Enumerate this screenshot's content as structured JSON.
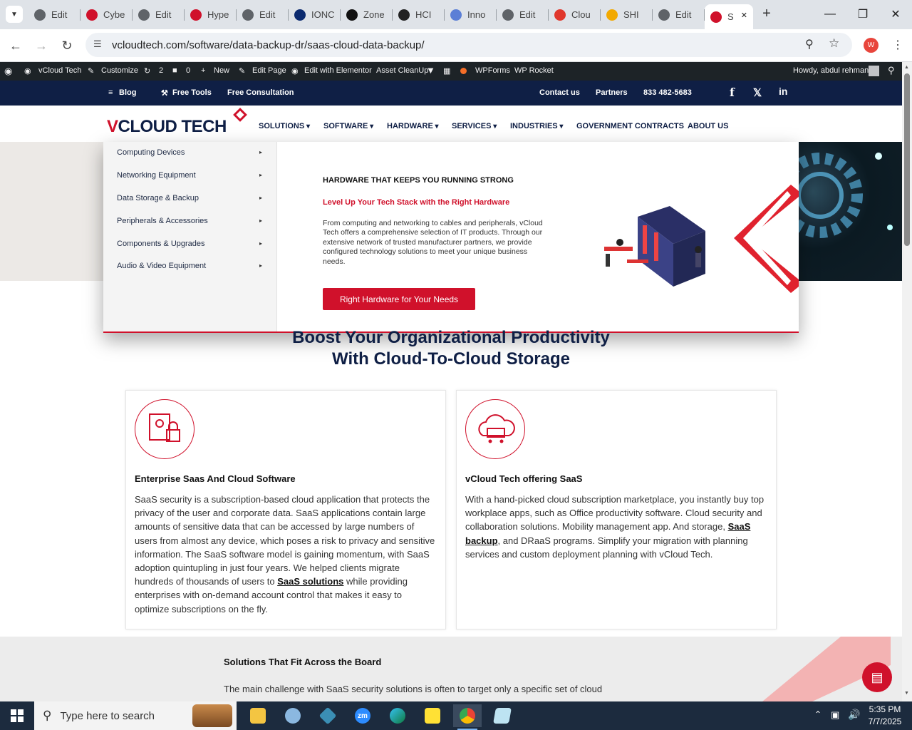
{
  "browser": {
    "tabs": [
      {
        "title": "Edit",
        "fav": "wordpress-icon",
        "color": "#5f6368"
      },
      {
        "title": "Cybe",
        "fav": "vcloud-diamond-icon",
        "color": "#d0112b"
      },
      {
        "title": "Edit",
        "fav": "wordpress-icon",
        "color": "#5f6368"
      },
      {
        "title": "Hype",
        "fav": "vcloud-diamond-icon",
        "color": "#d0112b"
      },
      {
        "title": "Edit",
        "fav": "wordpress-icon",
        "color": "#5f6368"
      },
      {
        "title": "IONC",
        "fav": "ionos-icon",
        "color": "#0b2a6f"
      },
      {
        "title": "Zone",
        "fav": "z-icon",
        "color": "#111111"
      },
      {
        "title": "HCI",
        "fav": "hci-icon",
        "color": "#222222"
      },
      {
        "title": "Inno",
        "fav": "inno-icon",
        "color": "#5b7fd6"
      },
      {
        "title": "Edit",
        "fav": "wordpress-icon",
        "color": "#5f6368"
      },
      {
        "title": "Clou",
        "fav": "cloud-swoosh-icon",
        "color": "#e0372c"
      },
      {
        "title": "SHI",
        "fav": "shi-icon",
        "color": "#f2a900"
      },
      {
        "title": "Edit",
        "fav": "wordpress-icon",
        "color": "#5f6368"
      },
      {
        "title": "S",
        "fav": "vcloud-diamond-icon",
        "color": "#d0112b"
      }
    ],
    "url": "vcloudtech.com/software/data-backup-dr/saas-cloud-data-backup/",
    "profile_initial": "W"
  },
  "wpbar": {
    "site": "vCloud Tech",
    "customize": "Customize",
    "updates": "2",
    "comments": "0",
    "new": "New",
    "edit_page": "Edit Page",
    "elementor": "Edit with Elementor",
    "asset_cleanup": "Asset CleanUp",
    "wpforms": "WPForms",
    "wprocket": "WP Rocket",
    "howdy": "Howdy, abdul rehman"
  },
  "topbar": {
    "blog": "Blog",
    "free_tools": "Free Tools",
    "consultation": "Free Consultation",
    "contact": "Contact us",
    "partners": "Partners",
    "phone": "833 482-5683"
  },
  "logo": {
    "part1": "V",
    "part2": "CLOUD TECH"
  },
  "menu": [
    "SOLUTIONS",
    "SOFTWARE",
    "HARDWARE",
    "SERVICES",
    "INDUSTRIES",
    "GOVERNMENT CONTRACTS",
    "ABOUT US"
  ],
  "mega": {
    "items": [
      "Computing Devices",
      "Networking Equipment",
      "Data Storage & Backup",
      "Peripherals & Accessories",
      "Components & Upgrades",
      "Audio & Video Equipment"
    ],
    "title": "HARDWARE THAT KEEPS YOU RUNNING STRONG",
    "subtitle": "Level Up Your Tech Stack with the Right Hardware",
    "desc": "From computing and networking to cables and peripherals, vCloud Tech offers a comprehensive selection of IT products. Through our extensive network of trusted manufacturer partners, we provide configured technology solutions to meet your unique business needs.",
    "button": "Right Hardware for Your Needs"
  },
  "heading": {
    "line1": "Boost Your Organizational Productivity",
    "line2": "With Cloud-To-Cloud Storage"
  },
  "cards": [
    {
      "title": "Enterprise Saas And Cloud Software",
      "text_before": "SaaS security is a subscription-based cloud application that protects the privacy of the user and corporate data. SaaS applications contain large amounts of sensitive data that can be accessed by large numbers of users from almost any device, which poses a risk to privacy and sensitive information. The SaaS software model is gaining momentum, with SaaS adoption quintupling in just four years. We helped clients migrate hundreds of thousands of users to ",
      "link": "SaaS solutions",
      "text_after": " while providing enterprises with on-demand account control that makes it easy to optimize subscriptions on the fly."
    },
    {
      "title": "vCloud Tech offering SaaS",
      "text_before": "With a hand-picked cloud subscription marketplace, you instantly buy top workplace apps, such as Office productivity software. Cloud security and collaboration solutions. Mobility management app. And storage, ",
      "link": "SaaS backup",
      "text_after": ", and DRaaS programs. Simplify your migration with planning services and custom deployment planning with vCloud Tech."
    }
  ],
  "band": {
    "title": "Solutions That Fit Across the Board",
    "text": "The main challenge with SaaS security solutions is often to target only a specific set of cloud"
  },
  "taskbar": {
    "search_placeholder": "Type here to search",
    "time": "5:35 PM",
    "date": "7/7/2025"
  },
  "colors": {
    "brand_red": "#d0112b",
    "navy": "#0f1f45"
  }
}
